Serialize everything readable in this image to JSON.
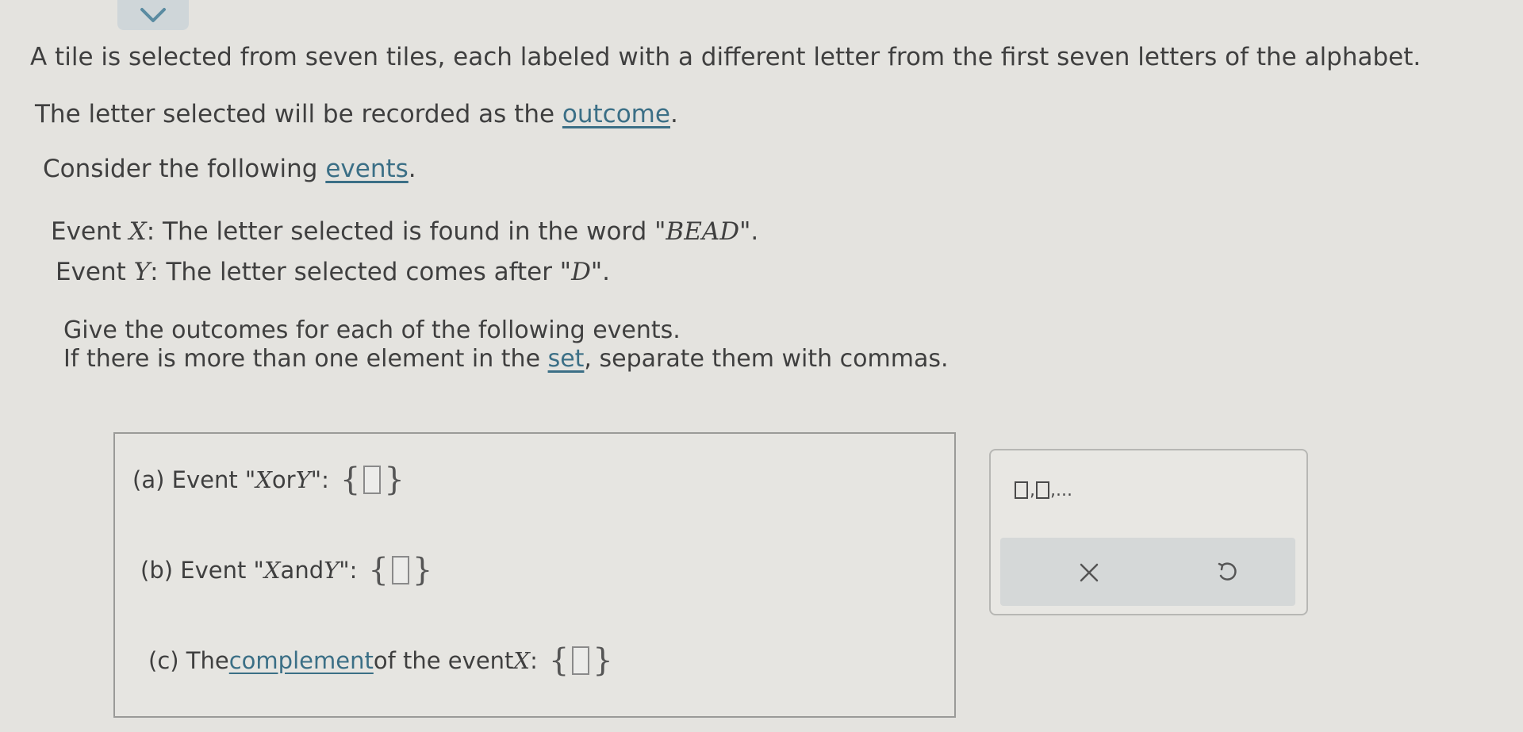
{
  "intro": {
    "line1": "A tile is selected from seven tiles, each labeled with a different letter from the first seven letters of the alphabet.",
    "line2_before": "The letter selected will be recorded as the ",
    "line2_link": "outcome",
    "line2_after": ".",
    "line3_before": "Consider the following ",
    "line3_link": "events",
    "line3_after": "."
  },
  "events": {
    "x": {
      "prefix": "Event ",
      "var": "X",
      "text": ": The letter selected is found in the word \"",
      "word": "BEAD",
      "suffix": "\"."
    },
    "y": {
      "prefix": "Event ",
      "var": "Y",
      "text": ": The letter selected comes after \"",
      "word": "D",
      "suffix": "\"."
    }
  },
  "instructions": {
    "line1": "Give the outcomes for each of the following events.",
    "line2_before": "If there is more than one element in the ",
    "line2_link": "set",
    "line2_after": ", separate them with commas."
  },
  "parts": {
    "a": {
      "label": "(a) Event \"",
      "var1": "X",
      "mid": " or ",
      "var2": "Y",
      "end": "\":"
    },
    "b": {
      "label": "(b) Event \"",
      "var1": "X",
      "mid": " and ",
      "var2": "Y",
      "end": "\":"
    },
    "c": {
      "before": "(c) The ",
      "link": "complement",
      "after": " of the event ",
      "var": "X",
      "end": ":"
    }
  },
  "set_braces": {
    "open": "{",
    "close": "}"
  },
  "toolbar": {
    "template_label": ",...",
    "icons": [
      "chevron-down-icon",
      "set-template-icon",
      "clear-x-icon",
      "undo-icon"
    ]
  },
  "colors": {
    "background": "#e4e3df",
    "link": "#3b6f86",
    "text": "#3f3f3f",
    "tab": "#cfd6d9",
    "action_bar": "#d5d8d8"
  }
}
